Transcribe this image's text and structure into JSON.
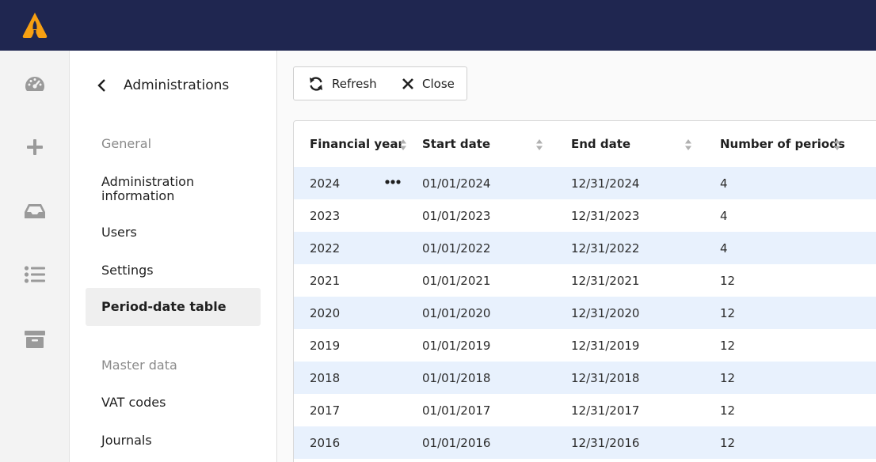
{
  "colors": {
    "topbar": "#1f2650",
    "accent": "#f7a012",
    "row_highlight": "#e8f1fd",
    "active_item": "#efefef"
  },
  "rail": {
    "icons": [
      "dashboard-gauge-icon",
      "plus-icon",
      "inbox-tray-icon",
      "list-icon",
      "archive-box-icon"
    ]
  },
  "subnav": {
    "title": "Administrations",
    "sections": [
      {
        "label": "General",
        "items": [
          "Administration information",
          "Users",
          "Settings",
          "Period-date table"
        ]
      },
      {
        "label": "Master data",
        "items": [
          "VAT codes",
          "Journals"
        ]
      }
    ],
    "active_item": "Period-date table"
  },
  "toolbar": {
    "refresh_label": "Refresh",
    "close_label": "Close"
  },
  "table": {
    "columns": [
      "Financial year",
      "Start date",
      "End date",
      "Number of periods"
    ],
    "rows": [
      {
        "year": "2024",
        "start": "01/01/2024",
        "end": "12/31/2024",
        "periods": "4"
      },
      {
        "year": "2023",
        "start": "01/01/2023",
        "end": "12/31/2023",
        "periods": "4"
      },
      {
        "year": "2022",
        "start": "01/01/2022",
        "end": "12/31/2022",
        "periods": "4"
      },
      {
        "year": "2021",
        "start": "01/01/2021",
        "end": "12/31/2021",
        "periods": "12"
      },
      {
        "year": "2020",
        "start": "01/01/2020",
        "end": "12/31/2020",
        "periods": "12"
      },
      {
        "year": "2019",
        "start": "01/01/2019",
        "end": "12/31/2019",
        "periods": "12"
      },
      {
        "year": "2018",
        "start": "01/01/2018",
        "end": "12/31/2018",
        "periods": "12"
      },
      {
        "year": "2017",
        "start": "01/01/2017",
        "end": "12/31/2017",
        "periods": "12"
      },
      {
        "year": "2016",
        "start": "01/01/2016",
        "end": "12/31/2016",
        "periods": "12"
      }
    ]
  }
}
